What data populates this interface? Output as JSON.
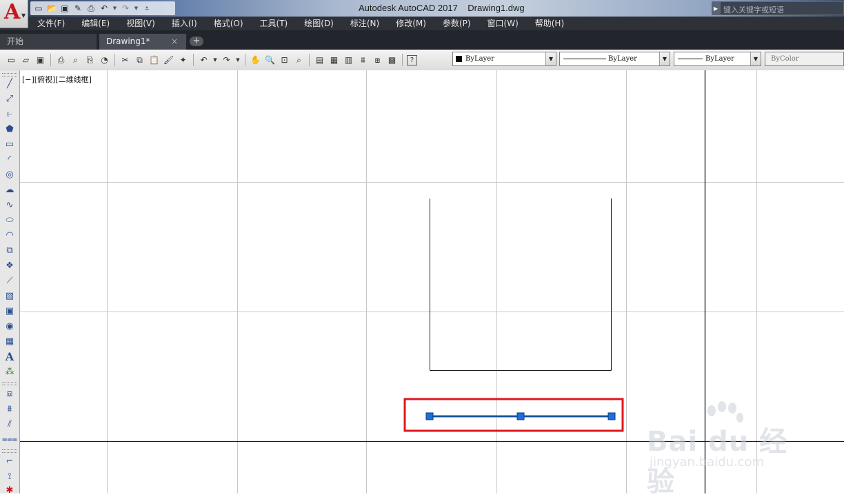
{
  "app": {
    "title": "Autodesk AutoCAD 2017    Drawing1.dwg",
    "search_placeholder": "键入关键字或短语",
    "logo_letter": "A"
  },
  "quick_access": {
    "icons": [
      "new-icon",
      "open-icon",
      "save-icon",
      "saveas-icon",
      "plot-icon",
      "undo-icon",
      "redo-icon",
      "customize-icon"
    ]
  },
  "menu": {
    "items": [
      "文件(F)",
      "编辑(E)",
      "视图(V)",
      "插入(I)",
      "格式(O)",
      "工具(T)",
      "绘图(D)",
      "标注(N)",
      "修改(M)",
      "参数(P)",
      "窗口(W)",
      "帮助(H)"
    ]
  },
  "tabs": {
    "start": "开始",
    "drawing": "Drawing1*",
    "close": "×",
    "add": "+"
  },
  "toolbar": {
    "color": "ByLayer",
    "linetype": "ByLayer",
    "lineweight": "ByLayer",
    "plotstyle": "ByColor"
  },
  "viewport": {
    "label": "[−][俯视][二维线框]"
  },
  "watermark": {
    "brand": "Bai du 经验",
    "url": "jingyan.baidu.com"
  },
  "colors": {
    "selection_highlight": "#e3151b",
    "grip": "#1e6fd9",
    "grid": "#c8c8c8",
    "axis": "#1a1a1a",
    "menubar": "#2f3138"
  }
}
